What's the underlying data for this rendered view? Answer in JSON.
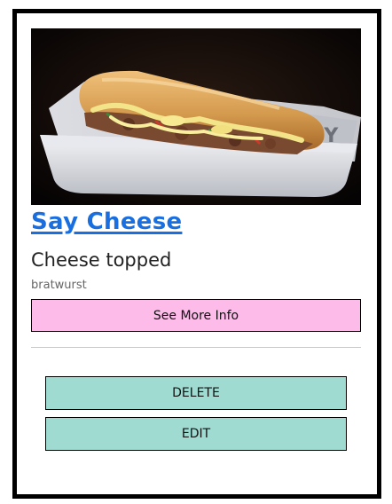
{
  "card": {
    "image": {
      "icon": "food-photo-hotdog"
    },
    "title": "Say Cheese",
    "subtitle": "Cheese topped",
    "category": "bratwurst",
    "info_button_label": "See More Info"
  },
  "actions": {
    "delete_label": "DELETE",
    "edit_label": "EDIT"
  },
  "colors": {
    "title_link": "#1a6fe0",
    "info_button_bg": "#fcbbe9",
    "action_button_bg": "#9fdbd1",
    "card_border": "#000000"
  }
}
